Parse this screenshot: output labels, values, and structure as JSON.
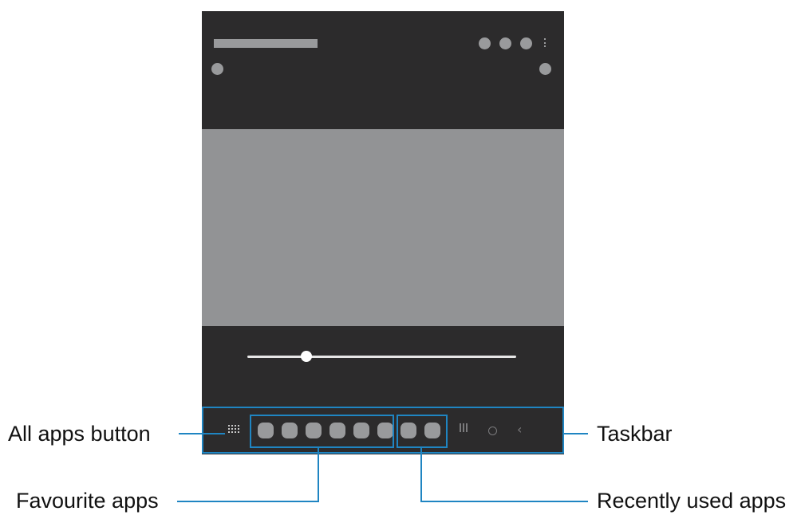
{
  "labels": {
    "all_apps_button": "All apps button",
    "taskbar": "Taskbar",
    "favourite_apps": "Favourite apps",
    "recently_used_apps": "Recently used apps"
  },
  "media_player": {
    "seek_progress": 0.22
  },
  "taskbar": {
    "favourite_app_count": 6,
    "recent_app_count": 2
  },
  "colors": {
    "screen_background": "#2c2b2c",
    "media_area": "#929395",
    "placeholder": "#999a9c",
    "callout": "#1f85c2"
  }
}
